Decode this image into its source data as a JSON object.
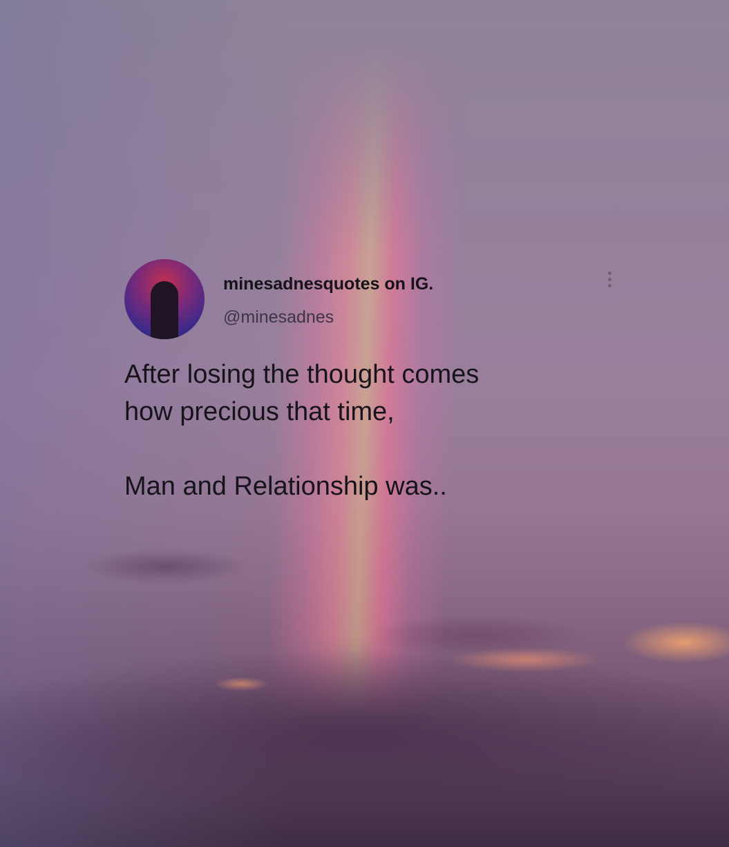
{
  "post": {
    "display_name": "minesadnesquotes on IG.",
    "handle": "@minesadnes",
    "avatar_icon": "profile-avatar",
    "more_icon": "vertical-ellipsis",
    "text": "After losing the thought comes\nhow precious that time,\n\nMan and Relationship was.."
  }
}
